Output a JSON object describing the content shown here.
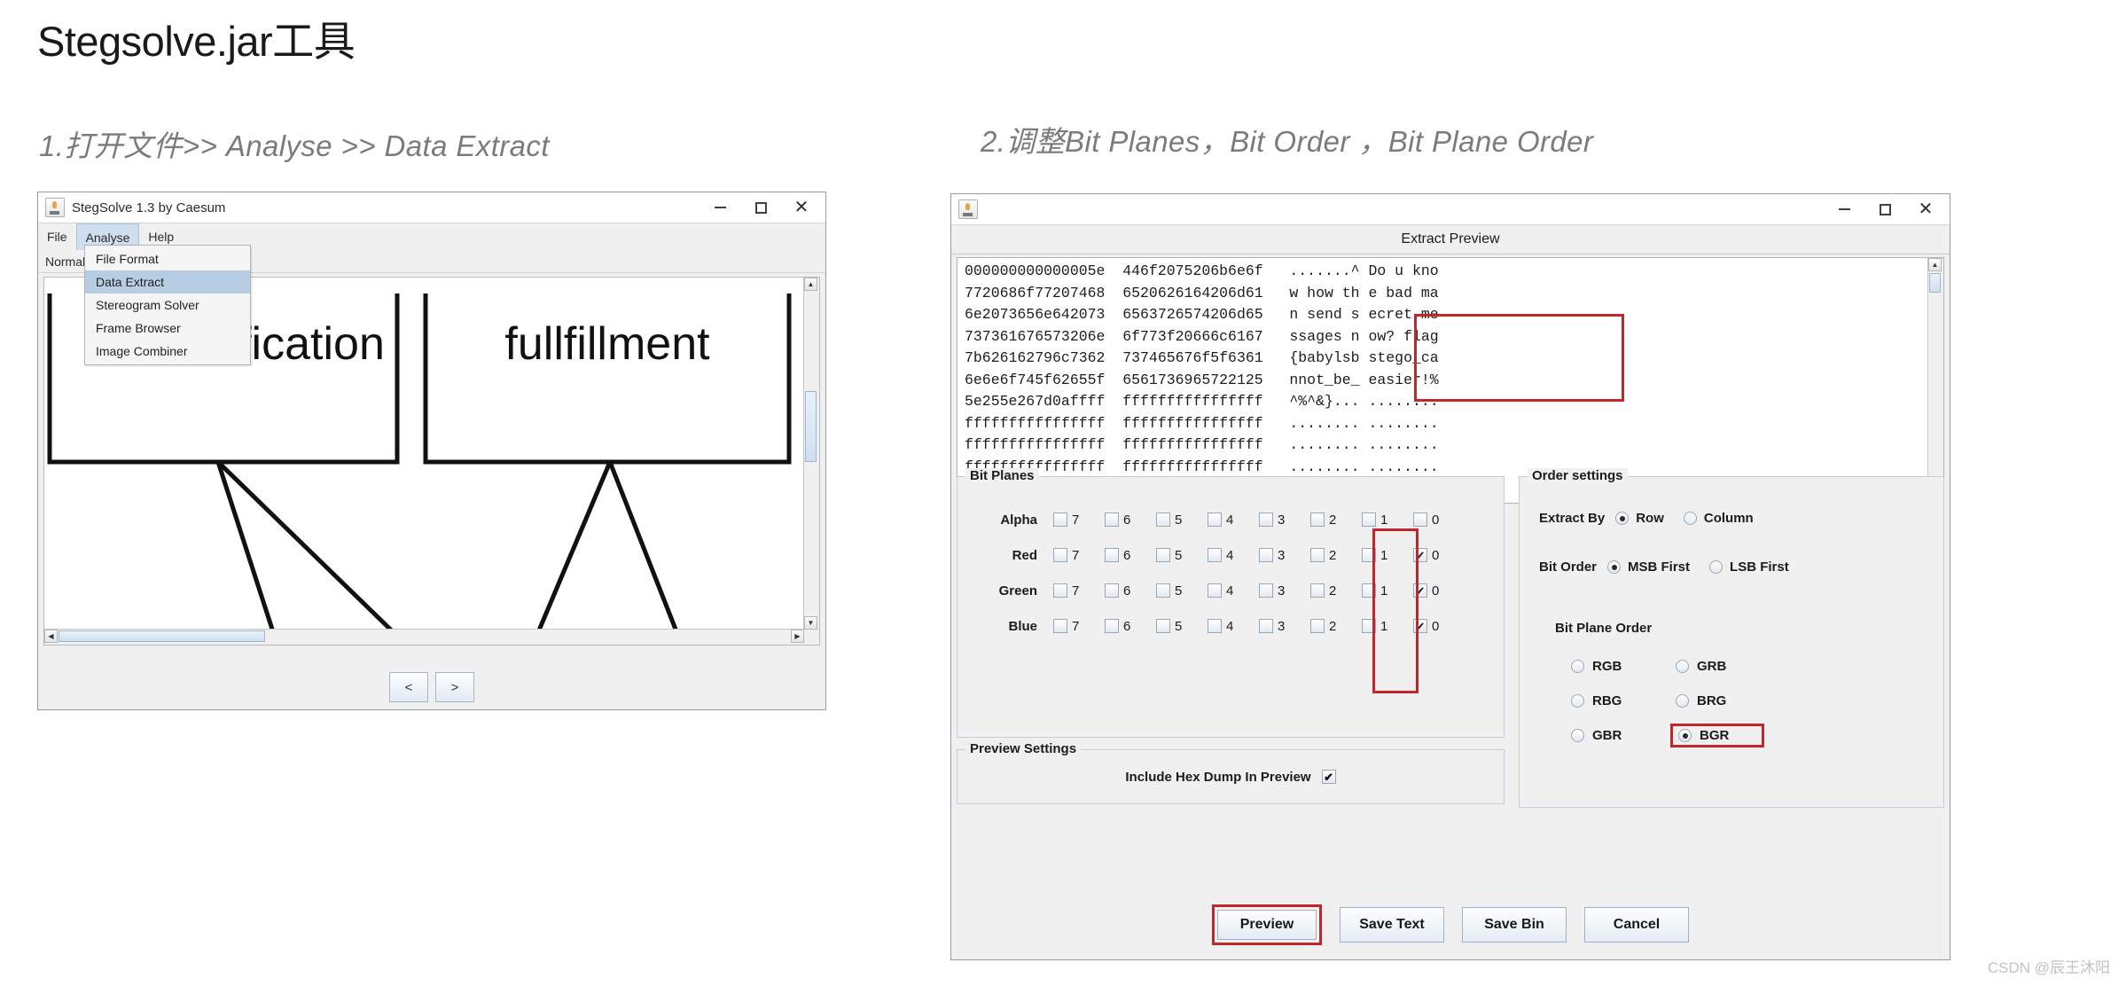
{
  "page": {
    "title": "Stegsolve.jar工具",
    "step1": "1.打开文件>> Analyse >> Data Extract",
    "step2": "2.调整Bit Planes，Bit Order ，Bit Plane Order",
    "watermark": "CSDN @辰王沐阳"
  },
  "stegsolve_window": {
    "title": "StegSolve 1.3 by Caesum",
    "icon": "app-icon",
    "window_controls": {
      "minimize": "–",
      "maximize": "□",
      "close": "✕"
    },
    "menubar": [
      {
        "label": "File",
        "active": false
      },
      {
        "label": "Analyse",
        "active": true
      },
      {
        "label": "Help",
        "active": false
      }
    ],
    "mode_label": "Normal",
    "analyse_menu": [
      {
        "label": "File Format",
        "selected": false
      },
      {
        "label": "Data Extract",
        "selected": true
      },
      {
        "label": "Stereogram Solver",
        "selected": false
      },
      {
        "label": "Frame Browser",
        "selected": false
      },
      {
        "label": "Image Combiner",
        "selected": false
      }
    ],
    "image_text": {
      "left": "lification",
      "right": "fullfillment"
    },
    "nav": {
      "prev": "<",
      "next": ">"
    }
  },
  "extract_window": {
    "icon": "app-icon",
    "window_controls": {
      "minimize": "–",
      "maximize": "□",
      "close": "✕"
    },
    "header": "Extract Preview",
    "hexdump": [
      "000000000000005e  446f2075206b6e6f   .......^ Do u kno",
      "7720686f77207468  6520626164206d61   w how th e bad ma",
      "6e2073656e642073  6563726574206d65   n send s ecret me",
      "737361676573206e  6f773f20666c6167   ssages n ow? flag",
      "7b626162796c7362  737465676f5f6361   {babylsb stego_ca",
      "6e6e6f745f62655f  6561736965722125   nnot_be_ easier!%",
      "5e255e267d0affff  ffffffffffffffff   ^%^&}... ........",
      "ffffffffffffffff  ffffffffffffffff   ........ ........",
      "ffffffffffffffff  ffffffffffffffff   ........ ........",
      "ffffffffffffffff  ffffffffffffffff   ........ ........"
    ],
    "bit_planes": {
      "group_title": "Bit Planes",
      "bits": [
        "7",
        "6",
        "5",
        "4",
        "3",
        "2",
        "1",
        "0"
      ],
      "rows": [
        {
          "channel": "Alpha",
          "checked": [
            false,
            false,
            false,
            false,
            false,
            false,
            false,
            false
          ]
        },
        {
          "channel": "Red",
          "checked": [
            false,
            false,
            false,
            false,
            false,
            false,
            false,
            true
          ]
        },
        {
          "channel": "Green",
          "checked": [
            false,
            false,
            false,
            false,
            false,
            false,
            false,
            true
          ]
        },
        {
          "channel": "Blue",
          "checked": [
            false,
            false,
            false,
            false,
            false,
            false,
            false,
            true
          ]
        }
      ],
      "check_glyph": "✔"
    },
    "preview_settings": {
      "group_title": "Preview Settings",
      "label": "Include Hex Dump In Preview",
      "checked": true,
      "check_glyph": "✔"
    },
    "order_settings": {
      "group_title": "Order settings",
      "extract_by": {
        "label": "Extract By",
        "options": [
          {
            "label": "Row",
            "selected": true
          },
          {
            "label": "Column",
            "selected": false
          }
        ]
      },
      "bit_order": {
        "label": "Bit Order",
        "options": [
          {
            "label": "MSB First",
            "selected": true
          },
          {
            "label": "LSB First",
            "selected": false
          }
        ]
      },
      "bit_plane_order": {
        "label": "Bit Plane Order",
        "options": [
          {
            "label": "RGB",
            "selected": false,
            "highlight": false
          },
          {
            "label": "GRB",
            "selected": false,
            "highlight": false
          },
          {
            "label": "RBG",
            "selected": false,
            "highlight": false
          },
          {
            "label": "BRG",
            "selected": false,
            "highlight": false
          },
          {
            "label": "GBR",
            "selected": false,
            "highlight": false
          },
          {
            "label": "BGR",
            "selected": true,
            "highlight": true
          }
        ]
      }
    },
    "buttons": [
      {
        "label": "Preview",
        "highlight": true
      },
      {
        "label": "Save Text",
        "highlight": false
      },
      {
        "label": "Save Bin",
        "highlight": false
      },
      {
        "label": "Cancel",
        "highlight": false
      }
    ]
  },
  "colors": {
    "highlight_red": "#c0282d",
    "menu_selected": "#b7cde3",
    "panel_bg": "#f0f0f0"
  }
}
